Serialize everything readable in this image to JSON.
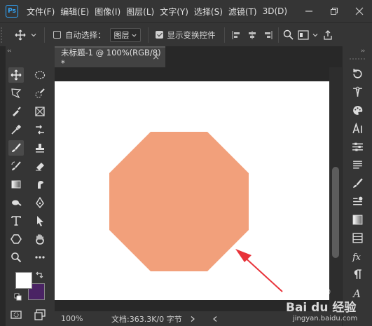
{
  "app": {
    "logo_text": "Ps"
  },
  "menu": [
    "文件(F)",
    "编辑(E)",
    "图像(I)",
    "图层(L)",
    "文字(Y)",
    "选择(S)",
    "滤镜(T)",
    "3D(D)"
  ],
  "options": {
    "auto_select_label": "自动选择：",
    "auto_select_checked": false,
    "layer_select_value": "图层",
    "show_transform_label": "显示变换控件",
    "show_transform_checked": true
  },
  "document": {
    "tab_title": "未标题-1 @ 100%(RGB/8) *",
    "zoom": "100%",
    "doc_info": "文档:363.3K/0 字节"
  },
  "shape": {
    "fill_color": "#f2a07b"
  },
  "annotation": {
    "arrow_color": "#e8333a"
  },
  "swatches": {
    "foreground": "#ffffff",
    "background": "#4a2364"
  },
  "watermark": {
    "text": "Bai du 经验",
    "url": "jingyan.baidu.com"
  }
}
